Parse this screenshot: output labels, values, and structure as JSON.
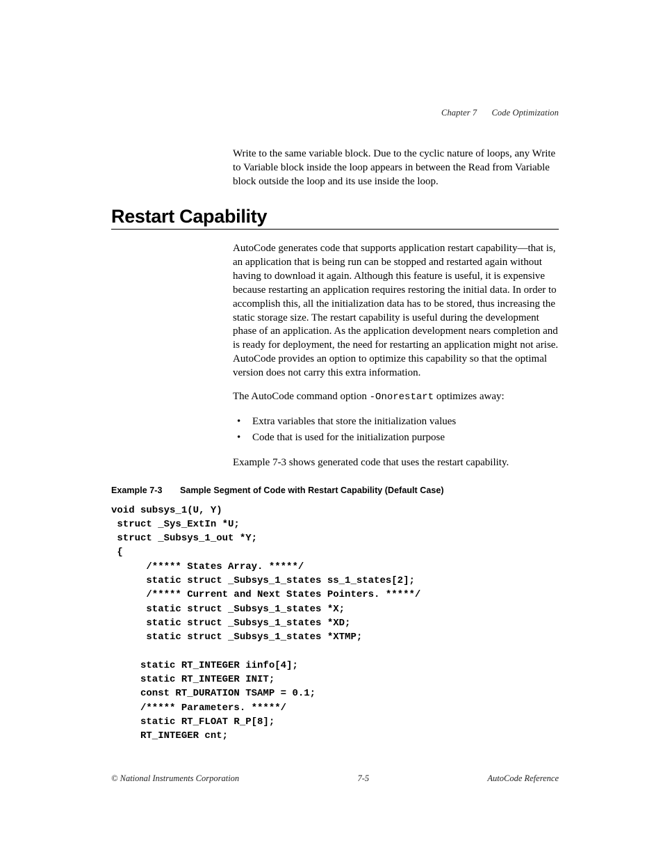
{
  "header": {
    "chapter": "Chapter 7",
    "title": "Code Optimization"
  },
  "intro_paragraph": "Write to the same variable block. Due to the cyclic nature of loops, any Write to Variable block inside the loop appears in between the Read from Variable block outside the loop and its use inside the loop.",
  "section": {
    "title": "Restart Capability",
    "para1": "AutoCode generates code that supports application restart capability—that is, an application that is being run can be stopped and restarted again without having to download it again. Although this feature is useful, it is expensive because restarting an application requires restoring the initial data. In order to accomplish this, all the initialization data has to be stored, thus increasing the static storage size. The restart capability is useful during the development phase of an application. As the application development nears completion and is ready for deployment, the need for restarting an application might not arise. AutoCode provides an option to optimize this capability so that the optimal version does not carry this extra information.",
    "para2_pre": "The AutoCode command option ",
    "para2_code": "-Onorestart",
    "para2_post": " optimizes away:",
    "bullets": [
      "Extra variables that store the initialization values",
      "Code that is used for the initialization purpose"
    ],
    "para3": "Example 7-3 shows generated code that uses the restart capability."
  },
  "example": {
    "label": "Example 7-3",
    "caption": "Sample Segment of Code with Restart Capability (Default Case)",
    "code": "void subsys_1(U, Y)\n struct _Sys_ExtIn *U;\n struct _Subsys_1_out *Y;\n {\n      /***** States Array. *****/\n      static struct _Subsys_1_states ss_1_states[2];\n      /***** Current and Next States Pointers. *****/\n      static struct _Subsys_1_states *X;\n      static struct _Subsys_1_states *XD;\n      static struct _Subsys_1_states *XTMP;\n\n     static RT_INTEGER iinfo[4];\n     static RT_INTEGER INIT;\n     const RT_DURATION TSAMP = 0.1;\n     /***** Parameters. *****/\n     static RT_FLOAT R_P[8];\n     RT_INTEGER cnt;"
  },
  "footer": {
    "left": "© National Instruments Corporation",
    "center": "7-5",
    "right": "AutoCode Reference"
  }
}
